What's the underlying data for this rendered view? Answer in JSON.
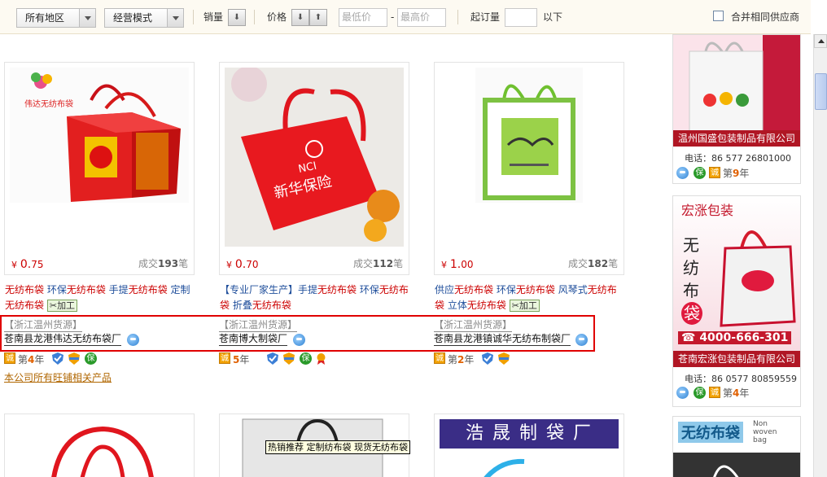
{
  "filter": {
    "region": "所有地区",
    "mode": "经营模式",
    "sales_label": "销量",
    "price_label": "价格",
    "min_price_placeholder": "最低价",
    "dash": "-",
    "max_price_placeholder": "最高价",
    "moq_label": "起订量",
    "below_label": "以下",
    "merge_label": "合并相同供应商",
    "down_arrow": "⬇",
    "up_arrow": "⬆"
  },
  "products": [
    {
      "yen": "¥",
      "price_int": "0.",
      "price_dec": "75",
      "sold_prefix": "成交",
      "sold_count": "193",
      "sold_suffix": "笔",
      "tags_html_parts": [
        {
          "t": "无纺布袋",
          "red": true
        },
        {
          "t": " 环保",
          "red": false
        },
        {
          "t": "无纺布袋",
          "red": true
        },
        {
          "t": " 手提",
          "red": false
        },
        {
          "t": "无纺布袋",
          "red": true
        },
        {
          "t": " 定制",
          "red": false
        },
        {
          "t": "无纺布袋",
          "red": true
        }
      ],
      "jg": "加工",
      "origin": "【浙江温州货源】",
      "company": "苍南县龙港伟达无纺布袋厂",
      "year_prefix": "第",
      "year": "4",
      "year_suffix": "年",
      "cheng": "诚",
      "bao": "保",
      "image_text_logo": "伟达无纺布袋"
    },
    {
      "yen": "¥",
      "price_int": "0.",
      "price_dec": "70",
      "sold_prefix": "成交",
      "sold_count": "112",
      "sold_suffix": "笔",
      "tags_html_parts": [
        {
          "t": "【专业厂家生产】手提",
          "red": false
        },
        {
          "t": "无纺布袋",
          "red": true
        },
        {
          "t": " 环保",
          "red": false
        },
        {
          "t": "无纺布袋",
          "red": true
        },
        {
          "t": " 折叠",
          "red": false
        },
        {
          "t": "无纺布袋",
          "red": true
        }
      ],
      "origin": "【浙江温州货源】",
      "company": "苍南博大制袋厂",
      "year_prefix": "",
      "year": "5",
      "year_suffix": "年",
      "cheng": "诚",
      "bao": "保",
      "image_text_brand": "NCI",
      "image_text_main": "新华保险"
    },
    {
      "yen": "¥",
      "price_int": "1.",
      "price_dec": "00",
      "sold_prefix": "成交",
      "sold_count": "182",
      "sold_suffix": "笔",
      "tags_html_parts": [
        {
          "t": "供应",
          "red": false
        },
        {
          "t": "无纺布袋",
          "red": true
        },
        {
          "t": " 环保",
          "red": false
        },
        {
          "t": "无纺布袋",
          "red": true
        },
        {
          "t": " 风琴式",
          "red": false
        },
        {
          "t": "无纺布袋",
          "red": true
        },
        {
          "t": " 立体",
          "red": false
        },
        {
          "t": "无纺布袋",
          "red": true
        }
      ],
      "jg": "加工",
      "origin": "【浙江温州货源】",
      "company": "苍南县龙港镇诚华无纺布制袋厂",
      "year_prefix": "第",
      "year": "2",
      "year_suffix": "年",
      "cheng": "诚"
    }
  ],
  "more_link": "本公司所有旺铺相关产品",
  "tooltip": "热销推荐 定制纺布袋 现货无纺布袋",
  "bottom_row": {
    "banner3": "浩 晟 制 袋 厂"
  },
  "ads": [
    {
      "company": "温州国盛包装制品有限公司",
      "tel": "电话：86 577 26801000",
      "year_prefix": "第",
      "year": "9",
      "year_suffix": "年",
      "cheng": "诚",
      "bao": "保"
    },
    {
      "brand": "宏涨包装",
      "vertical": [
        "无",
        "纺",
        "布",
        "袋"
      ],
      "phone": "☎ 4000-666-301",
      "company": "苍南宏涨包装制品有限公司",
      "tel": "电话：86  0577  80859559",
      "year_prefix": "第",
      "year": "4",
      "year_suffix": "年",
      "cheng": "诚",
      "bao": "保"
    },
    {
      "title": "无纺布袋",
      "sub1": "Non",
      "sub2": "woven",
      "sub3": "bag"
    }
  ]
}
